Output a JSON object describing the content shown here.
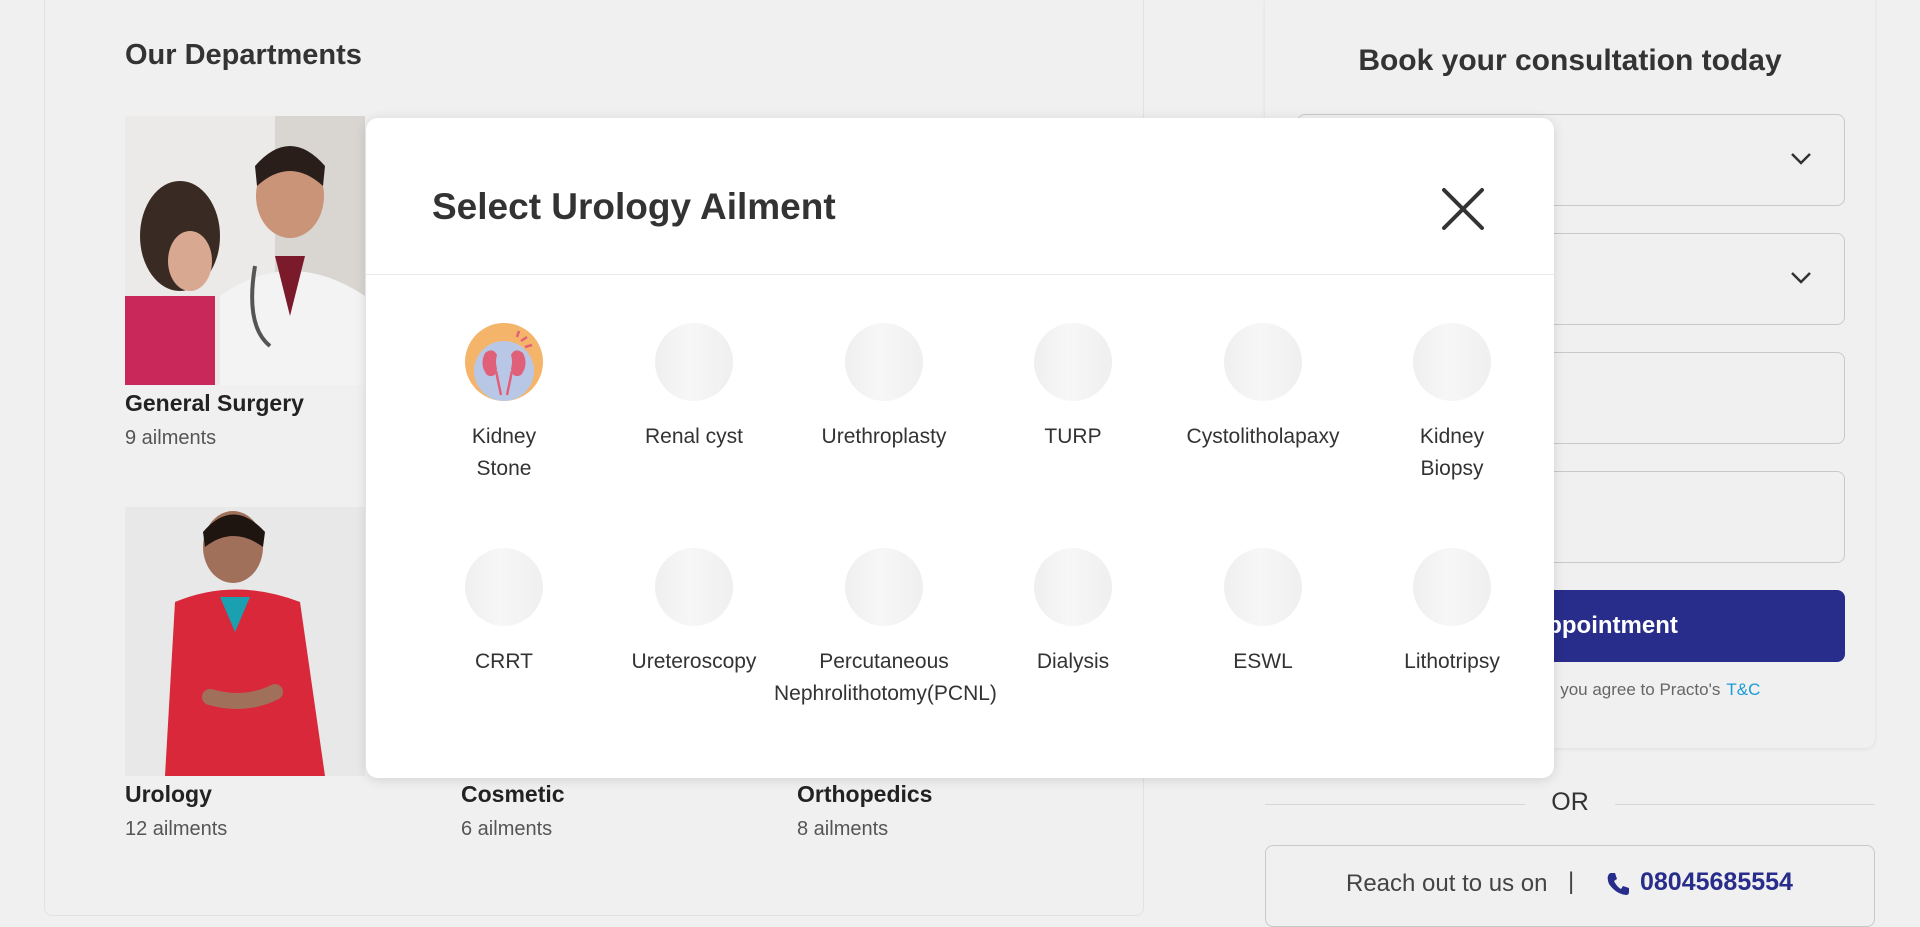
{
  "departments": {
    "title": "Our Departments",
    "items": [
      {
        "name": "General Surgery",
        "count": "9 ailments"
      },
      {
        "name": "Urology",
        "count": "12 ailments"
      },
      {
        "name": "Cosmetic",
        "count": "6 ailments"
      },
      {
        "name": "Orthopedics",
        "count": "8 ailments"
      }
    ]
  },
  "booking": {
    "title": "Book your consultation today",
    "button_label": "Book Appointment",
    "terms_text": "By submitting the form, you agree to Practo's",
    "terms_link": "T&C",
    "or_text": "OR",
    "reach_text": "Reach out to us on",
    "reach_separator": "|",
    "phone": "08045685554"
  },
  "modal": {
    "title": "Select Urology Ailment",
    "close_icon": "close-icon",
    "ailments": [
      {
        "label": "Kidney Stone",
        "icon": "kidney-icon"
      },
      {
        "label": "Renal cyst"
      },
      {
        "label": "Urethroplasty"
      },
      {
        "label": "TURP"
      },
      {
        "label": "Cystolitholapaxy"
      },
      {
        "label": "Kidney Biopsy"
      },
      {
        "label": "CRRT"
      },
      {
        "label": "Ureteroscopy"
      },
      {
        "label": "Percutaneous Nephrolithotomy(PCNL)"
      },
      {
        "label": "Dialysis"
      },
      {
        "label": "ESWL"
      },
      {
        "label": "Lithotripsy"
      }
    ]
  },
  "colors": {
    "accent": "#282d8b",
    "link": "#1a9bd7",
    "background": "#f0f0f0"
  }
}
